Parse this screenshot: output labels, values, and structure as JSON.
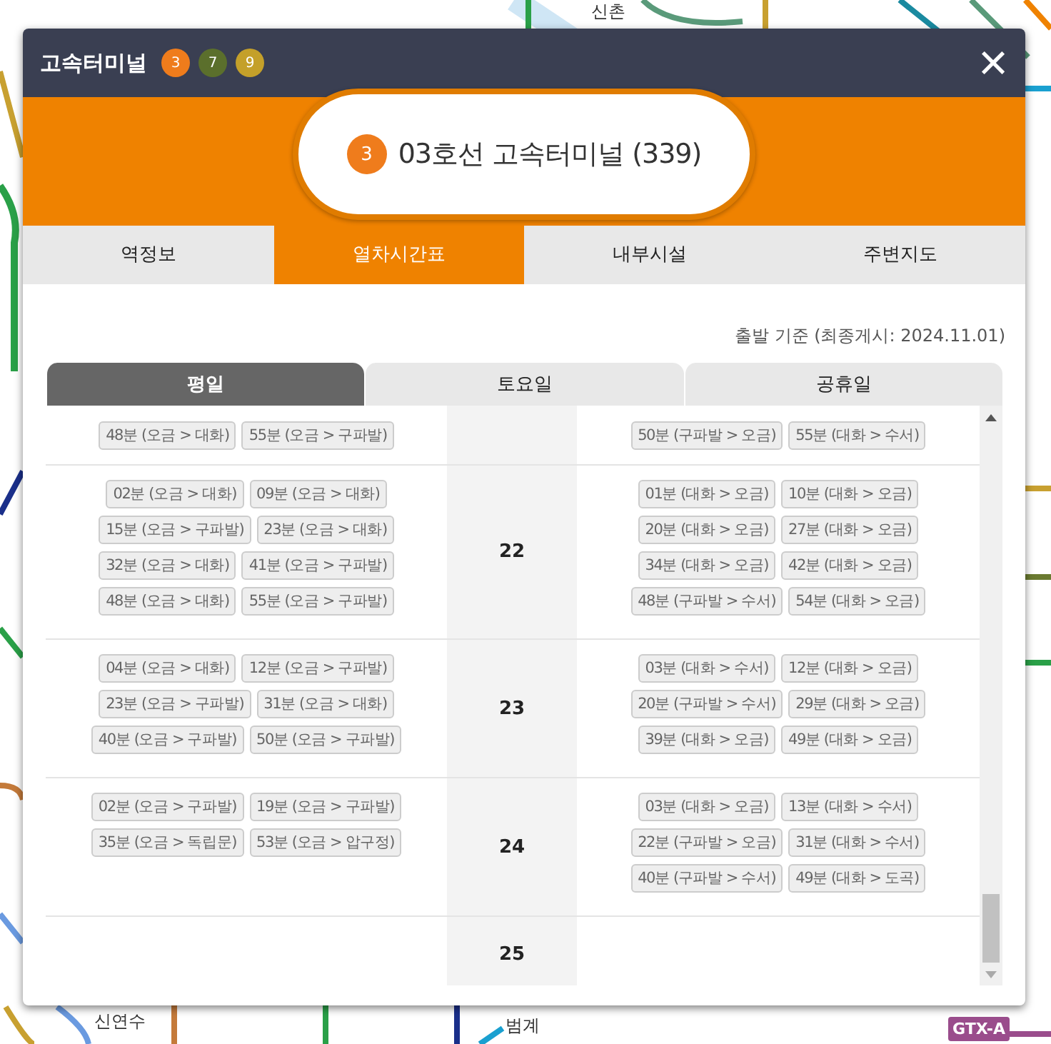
{
  "map": {
    "stations": [
      {
        "name": "신촌"
      },
      {
        "name": "신연수"
      },
      {
        "name": "범계"
      }
    ],
    "badge": "GTX-A"
  },
  "window": {
    "title": "고속터미널",
    "lines": [
      {
        "label": "3",
        "color": "#ef7c1c"
      },
      {
        "label": "7",
        "color": "#5b6f2c"
      },
      {
        "label": "9",
        "color": "#c4a02a"
      }
    ],
    "close": "×"
  },
  "station": {
    "line": "3",
    "color": "#ef7c1c",
    "name": "03호선 고속터미널 (339)"
  },
  "tabs": [
    {
      "label": "역정보",
      "selected": false
    },
    {
      "label": "열차시간표",
      "selected": true
    },
    {
      "label": "내부시설",
      "selected": false
    },
    {
      "label": "주변지도",
      "selected": false
    }
  ],
  "note": "출발 기준 (최종게시: 2024.11.01)",
  "day_tabs": [
    {
      "label": "평일",
      "selected": true
    },
    {
      "label": "토요일",
      "selected": false
    },
    {
      "label": "공휴일",
      "selected": false
    }
  ],
  "rows": [
    {
      "left": [
        "48분 (오금 > 대화)",
        "55분 (오금 > 구파발)"
      ],
      "right": [
        "50분 (구파발 > 오금)",
        "55분 (대화 > 수서)"
      ]
    },
    {
      "hour": "22",
      "left": [
        "02분 (오금 > 대화)",
        "09분 (오금 > 대화)",
        "15분 (오금 > 구파발)",
        "23분 (오금 > 대화)",
        "32분 (오금 > 대화)",
        "41분 (오금 > 구파발)",
        "48분 (오금 > 대화)",
        "55분 (오금 > 구파발)"
      ],
      "right": [
        "01분 (대화 > 오금)",
        "10분 (대화 > 오금)",
        "20분 (대화 > 오금)",
        "27분 (대화 > 오금)",
        "34분 (대화 > 오금)",
        "42분 (대화 > 오금)",
        "48분 (구파발 > 수서)",
        "54분 (대화 > 오금)"
      ]
    },
    {
      "hour": "23",
      "left": [
        "04분 (오금 > 대화)",
        "12분 (오금 > 구파발)",
        "23분 (오금 > 구파발)",
        "31분 (오금 > 대화)",
        "40분 (오금 > 구파발)",
        "50분 (오금 > 구파발)"
      ],
      "right": [
        "03분 (대화 > 수서)",
        "12분 (대화 > 오금)",
        "20분 (구파발 > 수서)",
        "29분 (대화 > 오금)",
        "39분 (대화 > 오금)",
        "49분 (대화 > 오금)"
      ]
    },
    {
      "hour": "24",
      "left": [
        "02분 (오금 > 구파발)",
        "19분 (오금 > 구파발)",
        "35분 (오금 > 독립문)",
        "53분 (오금 > 압구정)"
      ],
      "right": [
        "03분 (대화 > 오금)",
        "13분 (대화 > 수서)",
        "22분 (구파발 > 오금)",
        "31분 (대화 > 수서)",
        "40분 (구파발 > 수서)",
        "49분 (대화 > 도곡)"
      ]
    },
    {
      "hour": "25",
      "left": [],
      "right": []
    }
  ]
}
